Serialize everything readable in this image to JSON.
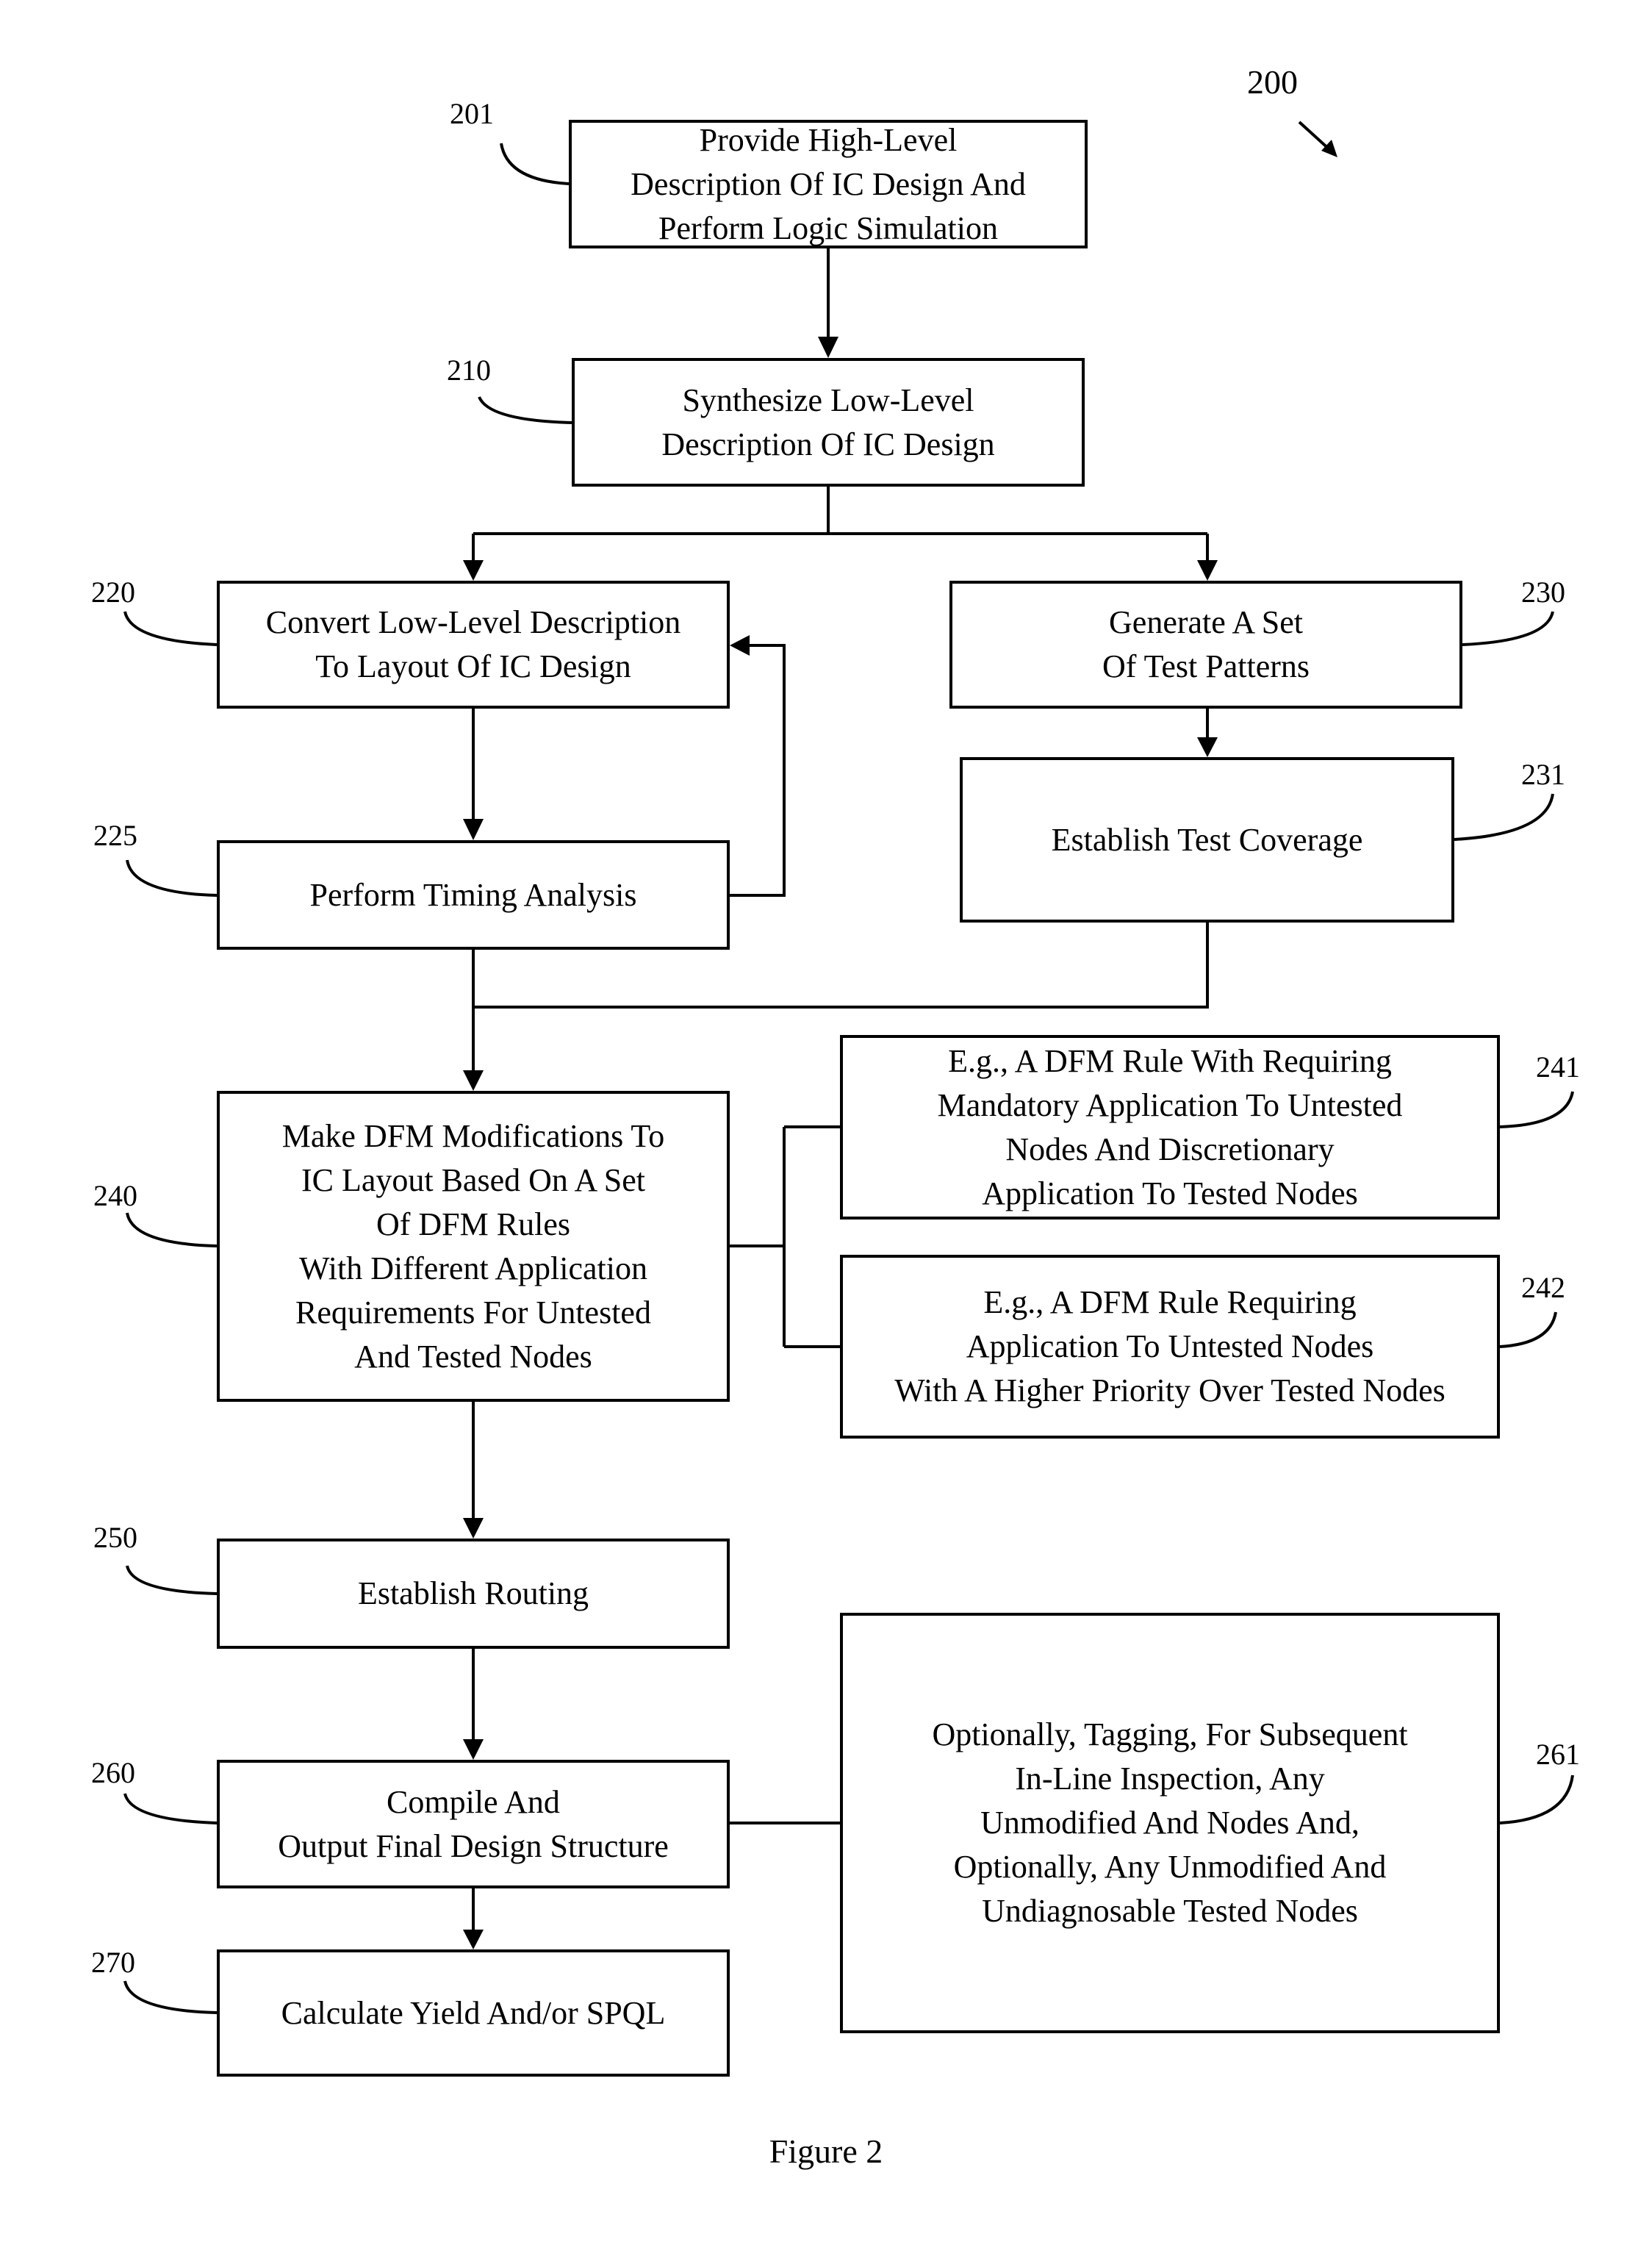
{
  "figure": {
    "ref": "200",
    "caption": "Figure 2"
  },
  "steps": {
    "s201": {
      "ref": "201",
      "text": "Provide High-Level\nDescription Of IC Design And\nPerform Logic Simulation"
    },
    "s210": {
      "ref": "210",
      "text": "Synthesize Low-Level\nDescription Of IC Design"
    },
    "s220": {
      "ref": "220",
      "text": "Convert Low-Level  Description\nTo Layout Of IC Design"
    },
    "s225": {
      "ref": "225",
      "text": "Perform Timing Analysis"
    },
    "s230": {
      "ref": "230",
      "text": "Generate A Set\nOf Test  Patterns"
    },
    "s231": {
      "ref": "231",
      "text": "Establish Test Coverage"
    },
    "s240": {
      "ref": "240",
      "text": "Make DFM Modifications To\nIC Layout  Based On A Set\nOf DFM  Rules\nWith Different Application\nRequirements For Untested\nAnd Tested Nodes"
    },
    "s241": {
      "ref": "241",
      "text": "E.g., A DFM Rule With Requiring\nMandatory  Application To Untested\nNodes And Discretionary\nApplication To Tested Nodes"
    },
    "s242": {
      "ref": "242",
      "text": "E.g., A DFM Rule Requiring\nApplication To Untested Nodes\nWith A Higher Priority Over Tested Nodes"
    },
    "s250": {
      "ref": "250",
      "text": "Establish Routing"
    },
    "s260": {
      "ref": "260",
      "text": "Compile And\nOutput Final Design Structure"
    },
    "s261": {
      "ref": "261",
      "text": "Optionally, Tagging, For Subsequent\nIn-Line Inspection, Any\nUnmodified And Nodes And,\nOptionally, Any Unmodified And\nUndiagnosable Tested Nodes"
    },
    "s270": {
      "ref": "270",
      "text": "Calculate Yield And/or SPQL"
    }
  }
}
